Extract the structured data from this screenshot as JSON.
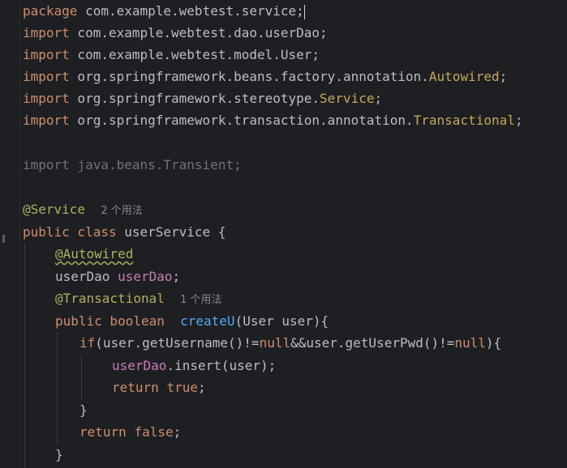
{
  "editor": {
    "line1": {
      "kw": "package",
      "text": " com.example.webtest.service;"
    },
    "line2": {
      "kw": "import",
      "text": " com.example.webtest.dao.userDao;"
    },
    "line3": {
      "kw": "import",
      "text": " com.example.webtest.model.User;"
    },
    "line4": {
      "kw": "import",
      "pre": " org.springframework.beans.factory.annotation.",
      "cls": "Autowired",
      "post": ";"
    },
    "line5": {
      "kw": "import",
      "pre": " org.springframework.stereotype.",
      "cls": "Service",
      "post": ";"
    },
    "line6": {
      "kw": "import",
      "pre": " org.springframework.transaction.annotation.",
      "cls": "Transactional",
      "post": ";"
    },
    "line7": {
      "text": "import java.beans.Transient;"
    },
    "line8": {
      "ann": "@Service",
      "hint": "2 个用法"
    },
    "line9": {
      "kw": "public class",
      "text": " userService {"
    },
    "line10": {
      "ann": "@Autowired"
    },
    "line11": {
      "type": "userDao ",
      "field": "userDao",
      "post": ";"
    },
    "line12": {
      "ann": "@Transactional",
      "hint": "1 个用法"
    },
    "line13": {
      "kw": "public boolean",
      "fn": "createU",
      "post": "(User user){"
    },
    "line14": {
      "kw1": "if",
      "mid1": "(user.getUsername()!=",
      "kw2": "null",
      "mid2": "&&user.getUserPwd()!=",
      "kw3": "null",
      "post": "){"
    },
    "line15": {
      "field": "userDao",
      "post": ".insert(user);"
    },
    "line16": {
      "kw1": "return",
      "kw2": "true",
      "post": ";"
    },
    "line17": {
      "text": "}"
    },
    "line18": {
      "kw1": "return",
      "kw2": "false",
      "post": ";"
    },
    "line19": {
      "text": "}"
    }
  },
  "colors": {
    "background": "#1e1f22",
    "keyword": "#cf8e6d",
    "annotation": "#b3ae60",
    "class": "#c7a65d",
    "field": "#c77dbb",
    "function": "#56a8f5",
    "text": "#bcbec4",
    "dimmed": "#6f737a"
  }
}
